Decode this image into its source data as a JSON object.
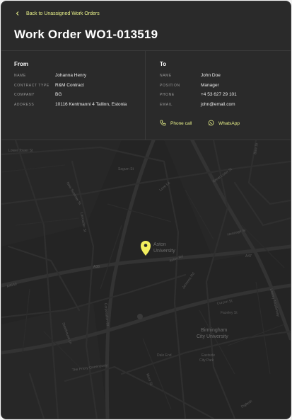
{
  "header": {
    "back_label": "Back to Unassigned Work Orders",
    "title": "Work Order WO1-013519"
  },
  "from": {
    "heading": "From",
    "fields": [
      {
        "label": "NAME",
        "value": "Johanna Henry"
      },
      {
        "label": "CONTRACT TYPE",
        "value": "R&M Contract"
      },
      {
        "label": "COMPANY",
        "value": "BG"
      },
      {
        "label": "ADDRESS",
        "value": "10116 Kentmanni 4 Tallinn, Estonia"
      }
    ]
  },
  "to": {
    "heading": "To",
    "fields": [
      {
        "label": "NAME",
        "value": "John Doe"
      },
      {
        "label": "POSITION",
        "value": "Manager"
      },
      {
        "label": "PHONE",
        "value": "+4 53 627 29 101"
      },
      {
        "label": "EMAIL",
        "value": "john@email.com"
      }
    ],
    "phone_call_label": "Phone call",
    "whatsapp_label": "WhatsApp"
  },
  "map": {
    "poi_1": "Aston",
    "poi_1b": "University",
    "poi_2": "Birmingham",
    "poi_2b": "City University",
    "poi_3": "Eastside",
    "poi_3b": "City Park",
    "streets": [
      "Lower Tower St",
      "Sagum St",
      "Love La",
      "Great Lister St",
      "A38",
      "A4540",
      "Aston Rd",
      "Jennens Rd",
      "Curzon St",
      "A47",
      "Fazeley St",
      "New Summer St",
      "Lancaster St",
      "Corporation St",
      "Steelhouse Ln",
      "Dale End",
      "Moor St",
      "Digbeth",
      "Bow St",
      "Heneage St",
      "Lawley Middleway",
      "The Priory Queensway"
    ]
  },
  "colors": {
    "accent": "#e9f28a",
    "panel": "#2a2a2a",
    "map": "#242424"
  }
}
